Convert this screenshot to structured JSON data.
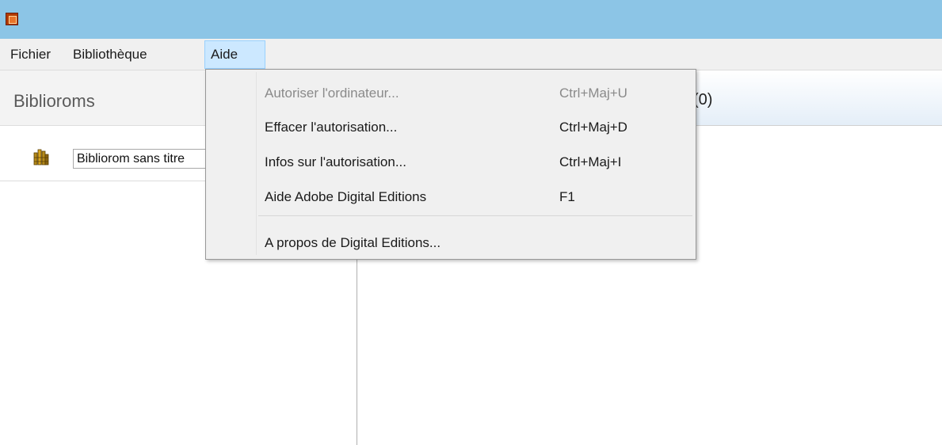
{
  "window": {
    "icon": "adobe-digital-editions-app-icon"
  },
  "menubar": {
    "items": [
      {
        "label": "Fichier"
      },
      {
        "label": "Bibliothèque"
      },
      {
        "label": "Aide"
      }
    ]
  },
  "sidebar": {
    "title": "Biblioroms",
    "shelf": {
      "icon": "bookshelf-icon",
      "name_value": "Bibliorom sans titre"
    }
  },
  "content": {
    "count": "(0)"
  },
  "aide_menu": {
    "items": [
      {
        "label": "Autoriser l'ordinateur...",
        "shortcut": "Ctrl+Maj+U",
        "enabled": false
      },
      {
        "label": "Effacer l'autorisation...",
        "shortcut": "Ctrl+Maj+D",
        "enabled": true
      },
      {
        "label": "Infos sur l'autorisation...",
        "shortcut": "Ctrl+Maj+I",
        "enabled": true
      },
      {
        "label": "Aide Adobe Digital Editions",
        "shortcut": "F1",
        "enabled": true
      },
      {
        "label": "A propos de Digital Editions...",
        "shortcut": "",
        "enabled": true
      }
    ]
  },
  "colors": {
    "titlebar": "#8cc5e6",
    "menu_highlight": "#cce8ff",
    "disabled_text": "#8a8a8a"
  }
}
